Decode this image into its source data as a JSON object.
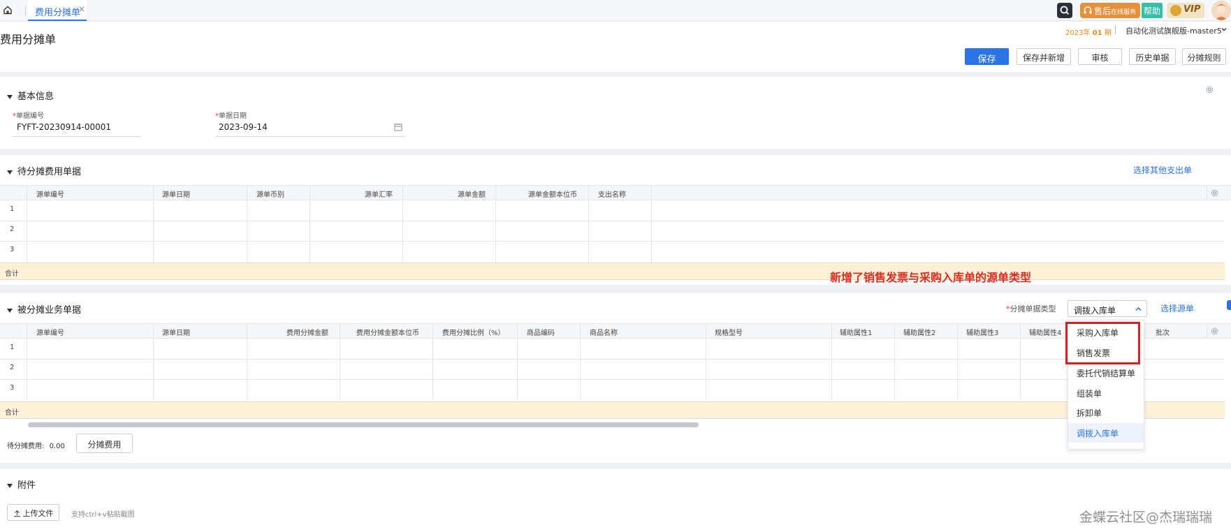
{
  "tabbar": {
    "tab_label": "费用分摊单",
    "close": "×"
  },
  "topright": {
    "after_sales": "售后",
    "after_sales_sub": "在线服务",
    "help": "帮助",
    "vip": "VIP"
  },
  "header": {
    "title": "费用分摊单",
    "period_year": "2023年",
    "period_num": "01",
    "period_unit": "期",
    "account": "自动化测试旗舰版-master5"
  },
  "toolbar": {
    "save": "保存",
    "save_new": "保存并新增",
    "audit": "审核",
    "history": "历史单据",
    "rules": "分摊规则"
  },
  "basic": {
    "title": "基本信息",
    "doc_no_label": "单据编号",
    "doc_no_value": "FYFT-20230914-00001",
    "doc_date_label": "单据日期",
    "doc_date_value": "2023-09-14",
    "required_mark": "*"
  },
  "pending": {
    "title": "待分摊费用单据",
    "select_other": "选择其他支出单",
    "columns": [
      "源单编号",
      "源单日期",
      "源单币别",
      "源单汇率",
      "源单金额",
      "源单金额本位币",
      "支出名称"
    ],
    "rows": [
      "1",
      "2",
      "3"
    ],
    "total": "合计"
  },
  "annotation": "新增了销售发票与采购入库单的源单类型",
  "allocated": {
    "title": "被分摊业务单据",
    "type_label": "分摊单据类型",
    "type_selected": "调拨入库单",
    "select_source": "选择源单",
    "columns": [
      "源单编号",
      "源单日期",
      "费用分摊金额",
      "费用分摊金额本位币",
      "费用分摊比例（%）",
      "商品编码",
      "商品名称",
      "规格型号",
      "辅助属性1",
      "辅助属性2",
      "辅助属性3",
      "辅助属性4",
      "批次"
    ],
    "rows": [
      "1",
      "2",
      "3"
    ],
    "total": "合计",
    "pending_label": "待分摊费用:",
    "pending_value": "0.00",
    "allocate_btn": "分摊费用"
  },
  "dropdown": {
    "options": [
      "采购入库单",
      "销售发票",
      "委托代销结算单",
      "组装单",
      "拆卸单",
      "调拨入库单"
    ],
    "active_index": 5
  },
  "attachments": {
    "title": "附件",
    "upload": "上传文件",
    "hint": "支持ctrl+v粘贴截图"
  },
  "watermark": "金蝶云社区@杰瑞瑞瑞",
  "colors": {
    "primary": "#2b74e6",
    "annotation_red": "#e02b20",
    "sum_bar": "#fdf1d8"
  }
}
